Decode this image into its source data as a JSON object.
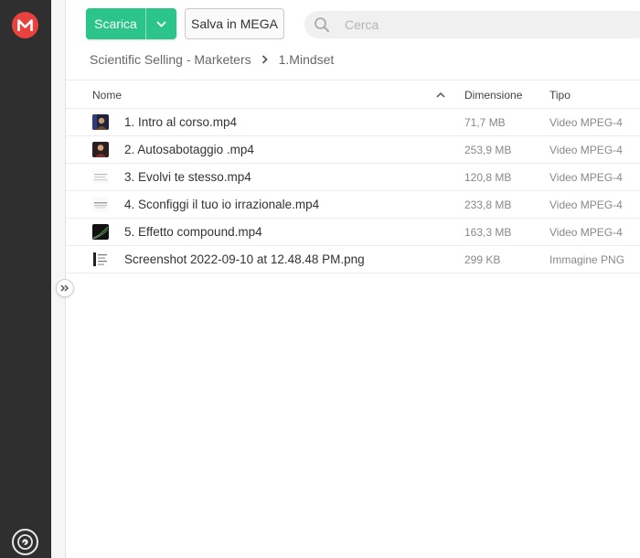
{
  "app": {
    "accent": "#e9413d",
    "primary": "#2bc48a",
    "rail_color": "#2f2f2f"
  },
  "toolbar": {
    "download_label": "Scarica",
    "save_label": "Salva in MEGA",
    "search_placeholder": "Cerca"
  },
  "breadcrumb": {
    "parent": "Scientific Selling - Marketers",
    "current": "1.Mindset"
  },
  "table": {
    "headers": {
      "name": "Nome",
      "size": "Dimensione",
      "type": "Tipo"
    },
    "sort": "ascending",
    "rows": [
      {
        "name": "1. Intro al corso.mp4",
        "size": "71,7 MB",
        "type": "Video MPEG-4",
        "thumb": "video-thumbnail-person"
      },
      {
        "name": "2. Autosabotaggio .mp4",
        "size": "253,9 MB",
        "type": "Video MPEG-4",
        "thumb": "video-thumbnail-person"
      },
      {
        "name": "3. Evolvi te stesso.mp4",
        "size": "120,8 MB",
        "type": "Video MPEG-4",
        "thumb": "video-thumbnail-slide"
      },
      {
        "name": "4. Sconfiggi il tuo io irrazionale.mp4",
        "size": "233,8 MB",
        "type": "Video MPEG-4",
        "thumb": "video-thumbnail-slide"
      },
      {
        "name": "5. Effetto compound.mp4",
        "size": "163,3 MB",
        "type": "Video MPEG-4",
        "thumb": "video-thumbnail-chart"
      },
      {
        "name": "Screenshot 2022-09-10 at 12.48.48 PM.png",
        "size": "299 KB",
        "type": "Immagine PNG",
        "thumb": "image-thumbnail-document"
      }
    ]
  },
  "icons": {
    "logo": "mega-logo-icon",
    "bottom": "speedometer-icon",
    "expand": "double-chevron-right-icon",
    "search": "search-icon",
    "dropdown": "chevron-down-icon",
    "breadcrumb_sep": "chevron-right-icon",
    "sort": "chevron-up-icon"
  }
}
